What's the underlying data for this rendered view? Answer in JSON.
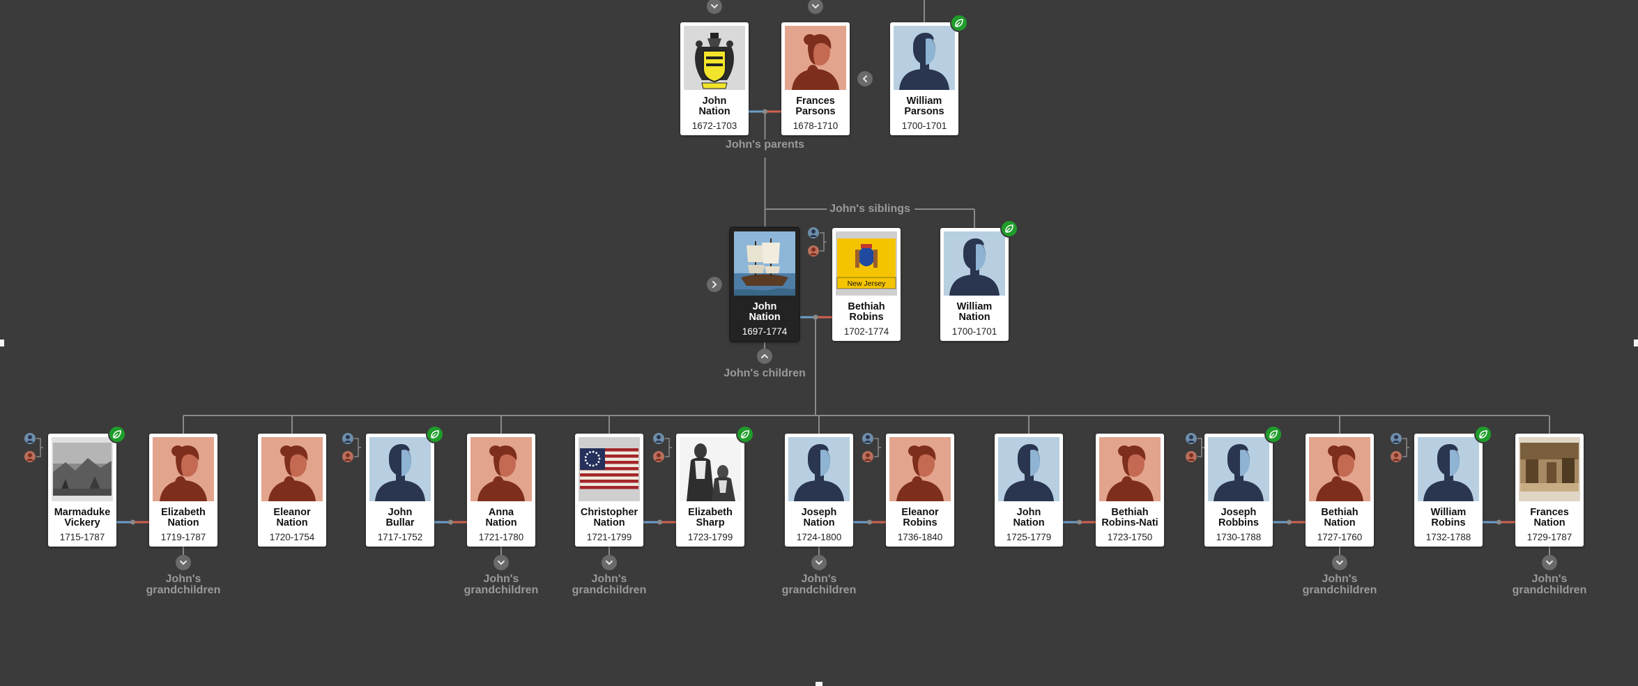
{
  "labels": {
    "parents": "John's parents",
    "siblings": "John's siblings",
    "children": "John's children",
    "grandchildren_line1": "John's",
    "grandchildren_line2": "grandchildren"
  },
  "parents_row": [
    {
      "name": "John\nNation",
      "dates": "1672-1703",
      "photo": "coat-of-arms",
      "hint": false
    },
    {
      "name": "Frances\nParsons",
      "dates": "1678-1710",
      "photo": "female-silhouette",
      "hint": false
    },
    {
      "name": "William\nParsons",
      "dates": "1700-1701",
      "photo": "male-silhouette",
      "hint": true
    }
  ],
  "focus_row": [
    {
      "name": "John\nNation",
      "dates": "1697-1774",
      "photo": "ship-painting",
      "hint": false,
      "focus": true
    },
    {
      "name": "Bethiah\nRobins",
      "dates": "1702-1774",
      "photo": "new-jersey-flag",
      "flag_text": "New Jersey",
      "hint": false
    },
    {
      "name": "William\nNation",
      "dates": "1700-1701",
      "photo": "male-silhouette",
      "hint": true
    }
  ],
  "children_row": [
    {
      "name": "Marmaduke\nVickery",
      "dates": "1715-1787",
      "photo": "bw-photo",
      "hint": true
    },
    {
      "name": "Elizabeth\nNation",
      "dates": "1719-1787",
      "photo": "female-silhouette",
      "hint": false
    },
    {
      "name": "Eleanor\nNation",
      "dates": "1720-1754",
      "photo": "female-silhouette",
      "hint": false
    },
    {
      "name": "John\nBullar",
      "dates": "1717-1752",
      "photo": "male-silhouette",
      "hint": true
    },
    {
      "name": "Anna\nNation",
      "dates": "1721-1780",
      "photo": "female-silhouette",
      "hint": false
    },
    {
      "name": "Christopher\nNation",
      "dates": "1721-1799",
      "photo": "us-flag",
      "hint": false
    },
    {
      "name": "Elizabeth\nSharp",
      "dates": "1723-1799",
      "photo": "engraving",
      "hint": true
    },
    {
      "name": "Joseph\nNation",
      "dates": "1724-1800",
      "photo": "male-silhouette",
      "hint": false
    },
    {
      "name": "Eleanor\nRobins",
      "dates": "1736-1840",
      "photo": "female-silhouette",
      "hint": false
    },
    {
      "name": "John\nNation",
      "dates": "1725-1779",
      "photo": "male-silhouette",
      "hint": false
    },
    {
      "name": "Bethiah\nRobins-Nati",
      "dates": "1723-1750",
      "photo": "female-silhouette",
      "hint": false
    },
    {
      "name": "Joseph\nRobbins",
      "dates": "1730-1788",
      "photo": "male-silhouette",
      "hint": true
    },
    {
      "name": "Bethiah\nNation",
      "dates": "1727-1760",
      "photo": "female-silhouette",
      "hint": false
    },
    {
      "name": "William\nRobins",
      "dates": "1732-1788",
      "photo": "male-silhouette",
      "hint": true
    },
    {
      "name": "Frances\nNation",
      "dates": "1729-1787",
      "photo": "sepia-photo",
      "hint": false
    }
  ],
  "colors": {
    "background": "#3b3b3b",
    "line": "#8a8a8a",
    "male_line": "#6e9ec7",
    "female_line": "#d0614f",
    "hint_badge": "#1f9d2b",
    "male_bg": "#b7cfe0",
    "male_figure": "#2a3550",
    "female_bg": "#e3a48e",
    "female_figure": "#7e2e1d"
  },
  "icons": {
    "hint": "leaf-hint-icon",
    "expand": "chevron-down-icon",
    "collapse": "chevron-up-icon",
    "left": "chevron-left-icon",
    "right": "chevron-right-icon",
    "add_parents": "add-parents-icon"
  }
}
